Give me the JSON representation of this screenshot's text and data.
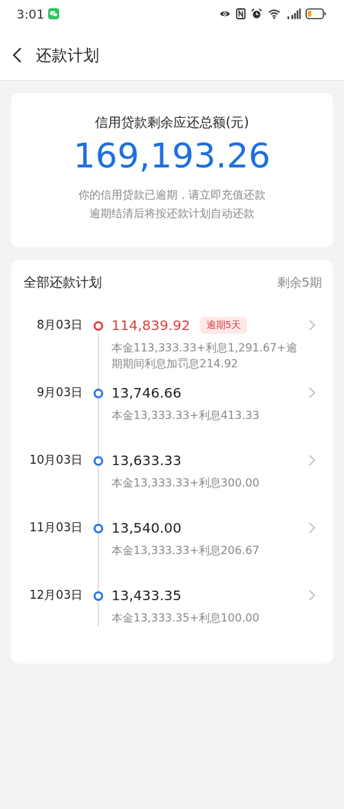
{
  "status_bar": {
    "time": "3:01"
  },
  "header": {
    "title": "还款计划"
  },
  "summary": {
    "label": "信用贷款剩余应还总额(元)",
    "amount": "169,193.26",
    "notes": [
      "你的信用贷款已逾期，请立即充值还款",
      "逾期结清后将按还款计划自动还款"
    ]
  },
  "plan": {
    "title": "全部还款计划",
    "remaining": "剩余5期",
    "items": [
      {
        "date": "8月03日",
        "amount": "114,839.92",
        "overdue": true,
        "badge": "逾期5天",
        "detail": "本金113,333.33+利息1,291.67+逾期期间利息加罚息214.92"
      },
      {
        "date": "9月03日",
        "amount": "13,746.66",
        "overdue": false,
        "detail": "本金13,333.33+利息413.33"
      },
      {
        "date": "10月03日",
        "amount": "13,633.33",
        "overdue": false,
        "detail": "本金13,333.33+利息300.00"
      },
      {
        "date": "11月03日",
        "amount": "13,540.00",
        "overdue": false,
        "detail": "本金13,333.33+利息206.67"
      },
      {
        "date": "12月03日",
        "amount": "13,433.35",
        "overdue": false,
        "detail": "本金13,333.35+利息100.00"
      }
    ]
  }
}
